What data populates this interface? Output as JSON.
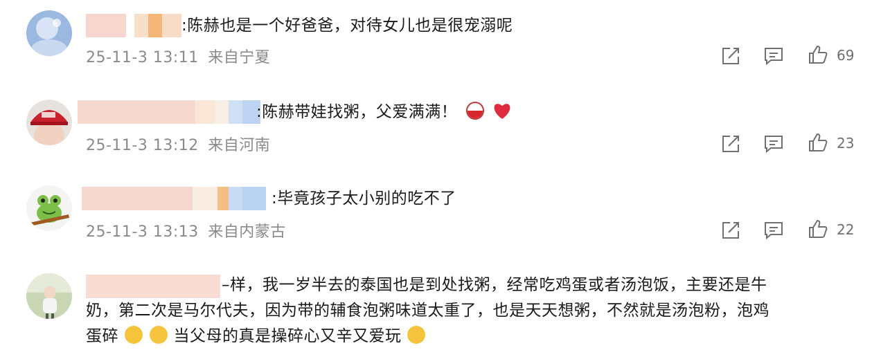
{
  "comments": [
    {
      "text": ":陈赫也是一个好爸爸，对待女儿也是很宠溺呢",
      "time": "25-11-3 13:11",
      "location": "来自宁夏",
      "likes": "69"
    },
    {
      "text": ":陈赫带娃找粥，父爱满满！",
      "time": "25-11-3 13:12",
      "location": "来自河南",
      "likes": "23"
    },
    {
      "text": ":毕竟孩子太小别的吃不了",
      "time": "25-11-3 13:13",
      "location": "来自内蒙古",
      "likes": "22"
    },
    {
      "text_line1": "–样，我一岁半去的泰国也是到处找粥，经常吃鸡蛋或者汤泡饭，主要还是牛",
      "text_line2": "奶，第二次是马尔代夫，因为带的辅食泡粥味道太重了，也是天天想粥，不然就是汤泡粉，泡鸡",
      "text_line3a": "蛋碎",
      "text_line3b": "当父母的真是操碎心又辛又爱玩"
    }
  ],
  "icons": {
    "share": "share-icon",
    "comment": "comment-icon",
    "like": "thumbs-up-icon",
    "emoji": "emoji-icon",
    "heart": "heart-icon"
  },
  "colors": {
    "meta_text": "#8a8a8a",
    "heart": "#e0245e",
    "blur_pink": "#f6c9c2",
    "blur_orange": "#f6b36a",
    "blur_blue": "#b9d3f2"
  }
}
